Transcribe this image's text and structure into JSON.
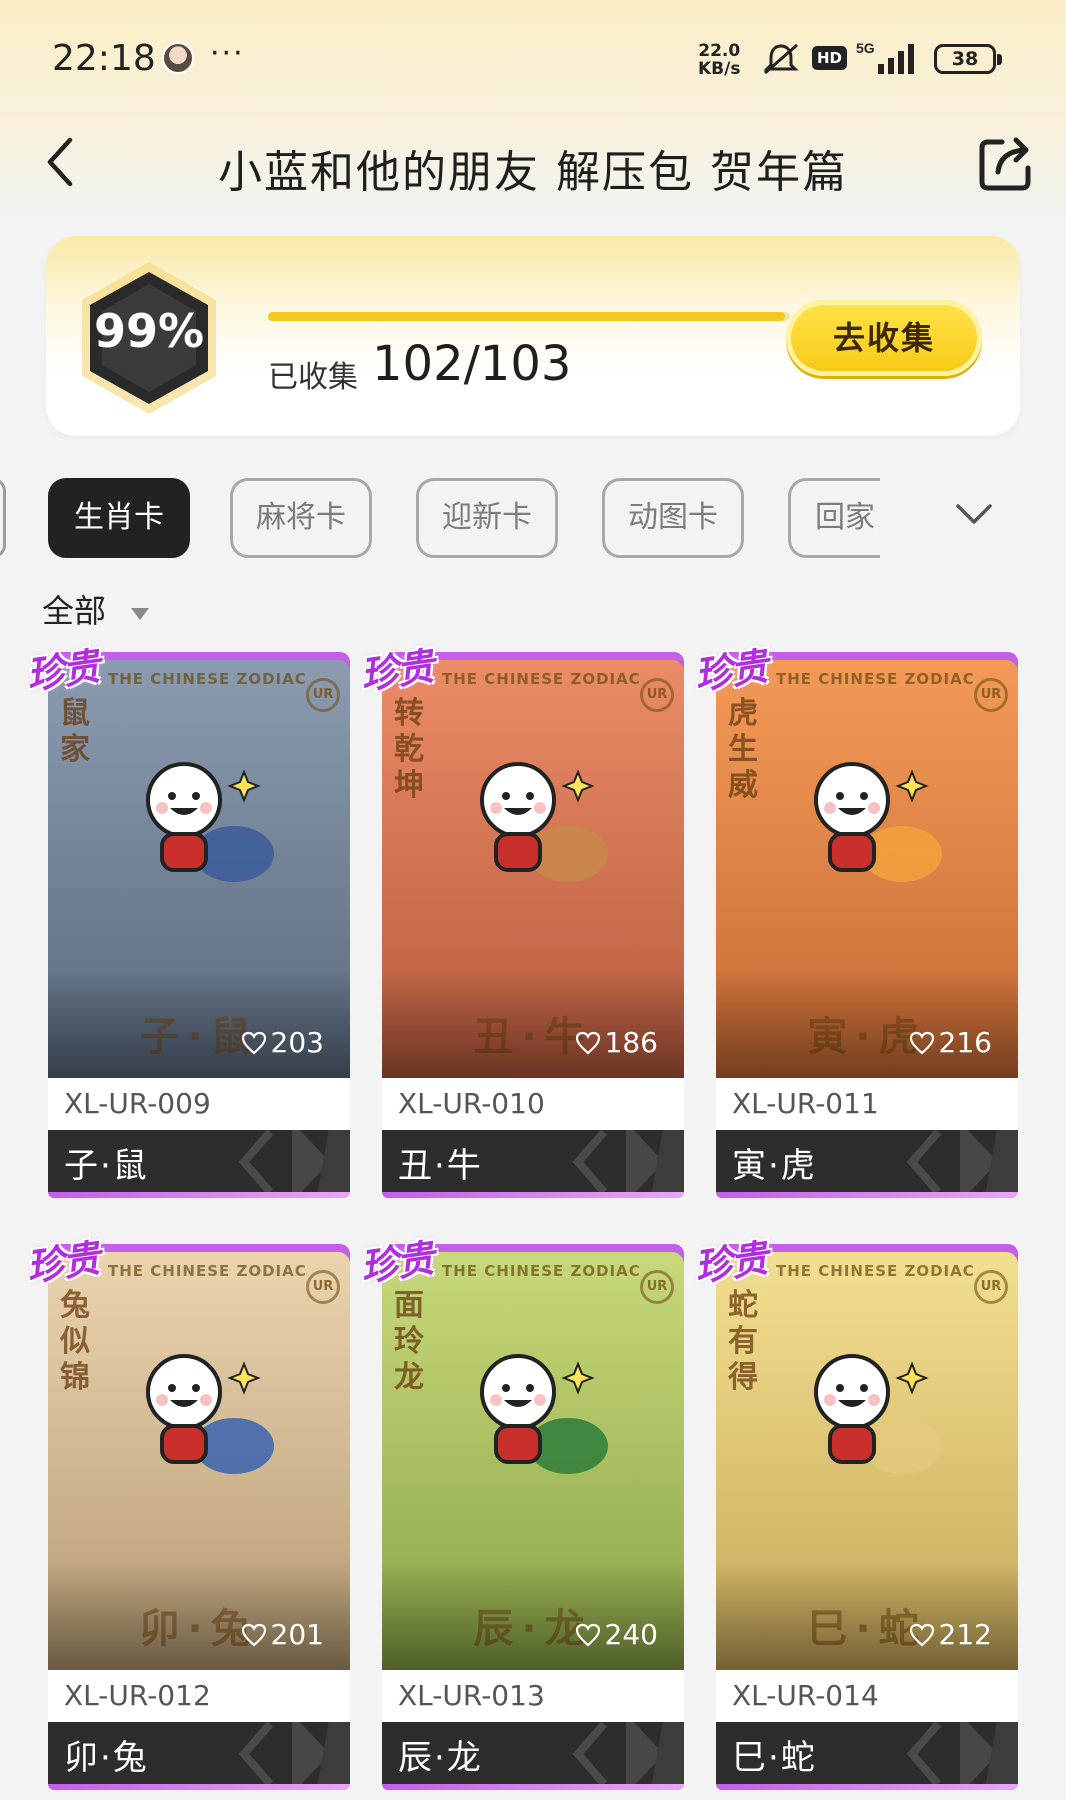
{
  "status_bar": {
    "time": "22:18",
    "more": "···",
    "net_speed_value": "22.0",
    "net_speed_unit": "KB/s",
    "hd": "HD",
    "network": "5G",
    "battery": "38"
  },
  "header": {
    "title": "小蓝和他的朋友 解压包 贺年篇"
  },
  "progress": {
    "percent_text": "99%",
    "fraction": 0.99,
    "collected_label": "已收集",
    "collected_count": "102/103",
    "collect_button": "去收集"
  },
  "tabs": [
    {
      "label": "生肖卡",
      "active": true
    },
    {
      "label": "麻将卡",
      "active": false
    },
    {
      "label": "迎新卡",
      "active": false
    },
    {
      "label": "动图卡",
      "active": false
    },
    {
      "label": "回家",
      "active": false
    }
  ],
  "filter": {
    "label": "全部"
  },
  "cards": [
    {
      "badge": "珍贵",
      "likes": "203",
      "code": "XL-UR-009",
      "name": "子·鼠",
      "vtext": "鼠家",
      "band": "THE CHINESE ZODIAC",
      "ur": "UR",
      "bottom_name": "子·鼠",
      "bg": [
        "#8b9bb0",
        "#5b6a7e"
      ],
      "accent": "#3c5d9a"
    },
    {
      "badge": "珍贵",
      "likes": "186",
      "code": "XL-UR-010",
      "name": "丑·牛",
      "vtext": "转乾坤",
      "band": "THE CHINESE ZODIAC",
      "ur": "UR",
      "bottom_name": "丑·牛",
      "bg": [
        "#ea8c66",
        "#b85a3e"
      ],
      "accent": "#c78a4a"
    },
    {
      "badge": "珍贵",
      "likes": "216",
      "code": "XL-UR-011",
      "name": "寅·虎",
      "vtext": "虎生威",
      "band": "THE CHINESE ZODIAC",
      "ur": "UR",
      "bottom_name": "寅·虎",
      "bg": [
        "#f39a57",
        "#c76a34"
      ],
      "accent": "#f2a13c"
    },
    {
      "badge": "珍贵",
      "likes": "201",
      "code": "XL-UR-012",
      "name": "卯·兔",
      "vtext": "兔似锦",
      "band": "THE CHINESE ZODIAC",
      "ur": "UR",
      "bottom_name": "卯·兔",
      "bg": [
        "#ead4ae",
        "#b59b73"
      ],
      "accent": "#3a64b0"
    },
    {
      "badge": "珍贵",
      "likes": "240",
      "code": "XL-UR-013",
      "name": "辰·龙",
      "vtext": "面玲龙",
      "band": "THE CHINESE ZODIAC",
      "ur": "UR",
      "bottom_name": "辰·龙",
      "bg": [
        "#c7d97a",
        "#8aa447"
      ],
      "accent": "#2e7d3a"
    },
    {
      "badge": "珍贵",
      "likes": "212",
      "code": "XL-UR-014",
      "name": "巳·蛇",
      "vtext": "蛇有得",
      "band": "THE CHINESE ZODIAC",
      "ur": "UR",
      "bottom_name": "巳·蛇",
      "bg": [
        "#f2df90",
        "#c8a85a"
      ],
      "accent": "#e3c97c"
    }
  ],
  "icons": {
    "back": "chevron-left-icon",
    "share": "share-icon",
    "expand": "chevron-down-icon",
    "heart": "heart-outline-icon",
    "dropdown": "caret-down-icon"
  },
  "colors": {
    "accent_yellow": "#f2c91e",
    "rare_purple": "#c35fe6",
    "dark": "#222222"
  }
}
